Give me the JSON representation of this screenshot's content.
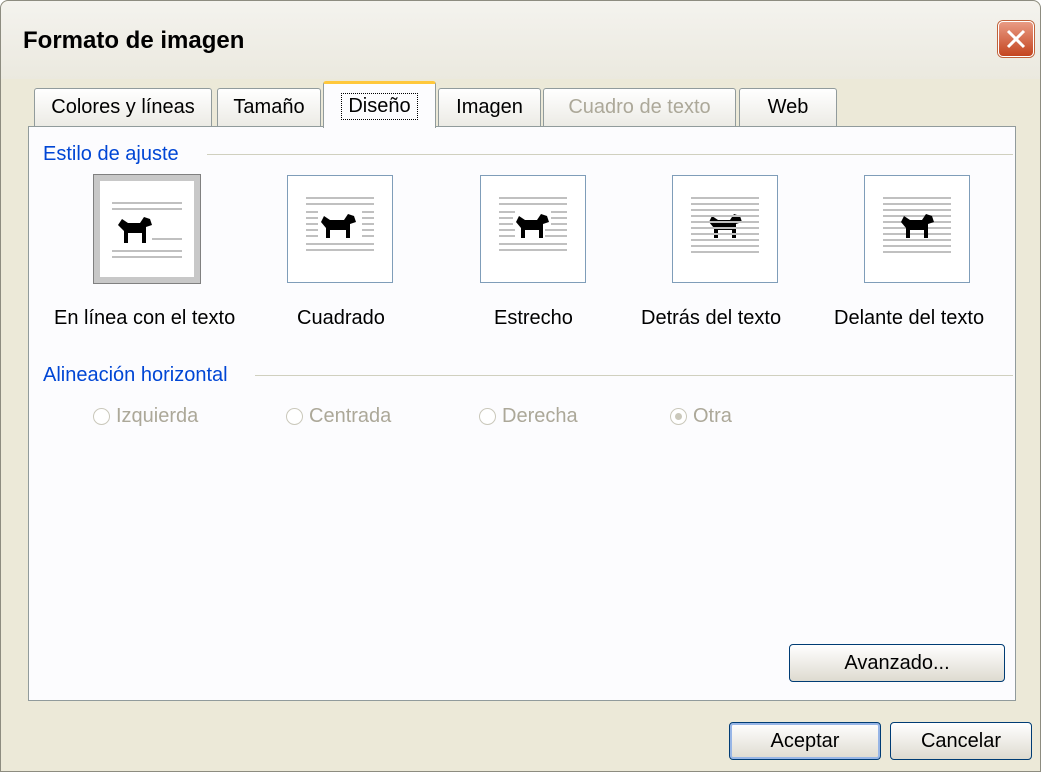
{
  "window": {
    "title": "Formato de imagen"
  },
  "tabs": [
    {
      "label": "Colores y líneas",
      "state": "normal"
    },
    {
      "label": "Tamaño",
      "state": "normal"
    },
    {
      "label": "Diseño",
      "state": "active"
    },
    {
      "label": "Imagen",
      "state": "normal"
    },
    {
      "label": "Cuadro de texto",
      "state": "disabled"
    },
    {
      "label": "Web",
      "state": "normal"
    }
  ],
  "wrap_style": {
    "title": "Estilo de ajuste",
    "options": [
      {
        "label": "En línea con el texto",
        "icon": "wrap-inline-icon",
        "selected": true
      },
      {
        "label": "Cuadrado",
        "icon": "wrap-square-icon",
        "selected": false
      },
      {
        "label": "Estrecho",
        "icon": "wrap-tight-icon",
        "selected": false
      },
      {
        "label": "Detrás del texto",
        "icon": "wrap-behind-icon",
        "selected": false
      },
      {
        "label": "Delante del texto",
        "icon": "wrap-front-icon",
        "selected": false
      }
    ]
  },
  "horizontal_alignment": {
    "title": "Alineación horizontal",
    "options": [
      {
        "label": "Izquierda",
        "checked": false
      },
      {
        "label": "Centrada",
        "checked": false
      },
      {
        "label": "Derecha",
        "checked": false
      },
      {
        "label": "Otra",
        "checked": true
      }
    ]
  },
  "buttons": {
    "advanced": "Avanzado...",
    "ok": "Aceptar",
    "cancel": "Cancelar"
  },
  "colors": {
    "accent_label": "#0046d5",
    "disabled_text": "#aca899",
    "close_button": "#c44520"
  }
}
